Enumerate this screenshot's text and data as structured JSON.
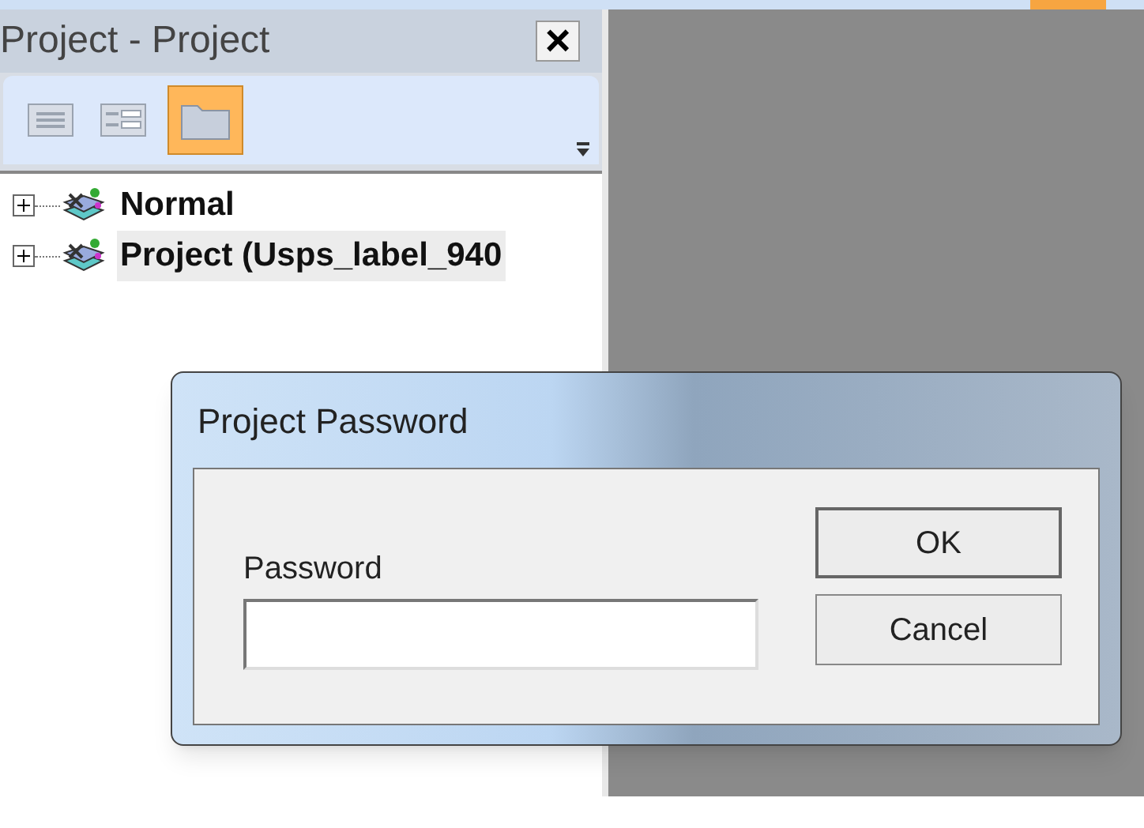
{
  "panel": {
    "title": "Project - Project",
    "close": "×"
  },
  "toolbar": [
    {
      "kind": "grid",
      "selected": false
    },
    {
      "kind": "form",
      "selected": false
    },
    {
      "kind": "folder",
      "selected": true
    }
  ],
  "tree": [
    {
      "label": "Normal",
      "expanded": false,
      "selected": false
    },
    {
      "label": "Project (Usps_label_940",
      "expanded": false,
      "selected": true
    }
  ],
  "dialog": {
    "title": "Project Password",
    "field_label": "Password",
    "buttons": [
      {
        "label": "OK",
        "kind": "default"
      },
      {
        "label": "Cancel",
        "kind": "normal"
      }
    ]
  }
}
